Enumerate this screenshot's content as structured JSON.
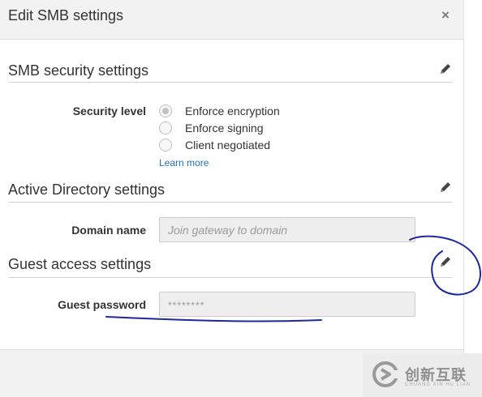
{
  "dialog": {
    "title": "Edit SMB settings",
    "close_symbol": "×",
    "close_icon": "close-icon"
  },
  "smb_security": {
    "title": "SMB security settings",
    "edit_icon": "pencil-icon",
    "security_level_label": "Security level",
    "options": [
      {
        "label": "Enforce encryption",
        "selected": true
      },
      {
        "label": "Enforce signing",
        "selected": false
      },
      {
        "label": "Client negotiated",
        "selected": false
      }
    ],
    "learn_more": "Learn more"
  },
  "active_directory": {
    "title": "Active Directory settings",
    "edit_icon": "pencil-icon",
    "domain_label": "Domain name",
    "domain_placeholder": "Join gateway to domain",
    "domain_value": ""
  },
  "guest_access": {
    "title": "Guest access settings",
    "edit_icon": "pencil-icon",
    "password_label": "Guest password",
    "password_placeholder": "********",
    "password_value": ""
  },
  "watermark": {
    "text": "创新互联",
    "subtext": "CHUANG XIN HU LIAN"
  },
  "colors": {
    "header_bg": "#f2f2f2",
    "link": "#1f6ebd",
    "annotation_ink": "#1a2a9e"
  }
}
